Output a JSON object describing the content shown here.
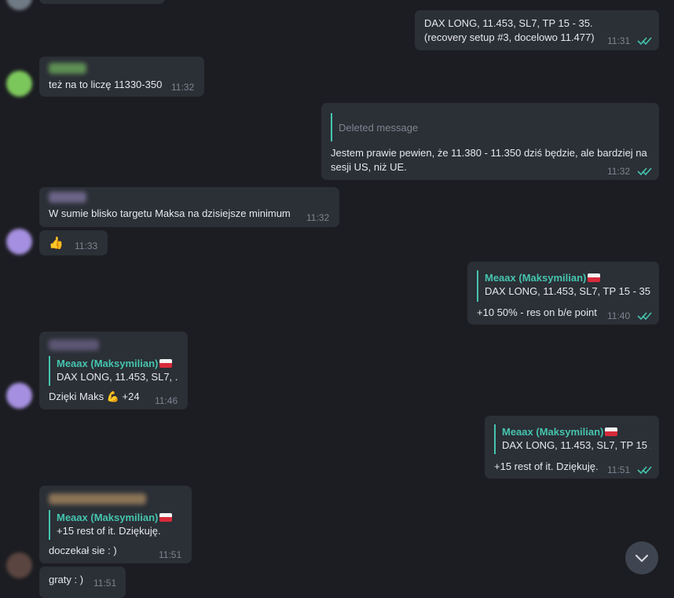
{
  "messages": {
    "m1": {
      "line1": "DAX LONG, 11.453, SL7, TP 15 - 35.",
      "line2": "(recovery setup #3, docelowo 11.477)",
      "time": "11:31"
    },
    "m2": {
      "text": "też na to liczę 11330-350",
      "time": "11:32"
    },
    "m3": {
      "quote": "Deleted message",
      "text": "Jestem prawie pewien, że 11.380 - 11.350 dziś będzie, ale bardziej na sesji US, niż UE.",
      "time": "11:32"
    },
    "m4": {
      "text": "W sumie blisko targetu Maksa na dzisiejsze minimum",
      "time": "11:32"
    },
    "m5": {
      "emoji": "👍",
      "time": "11:33"
    },
    "m6": {
      "quote_name": "Meaax (Maksymilian)",
      "quote_text": "DAX LONG, 11.453, SL7, TP 15 - 35....",
      "text": "+10 50% - res on b/e point",
      "time": "11:40"
    },
    "m7": {
      "quote_name": "Meaax (Maksymilian)",
      "quote_text": "DAX LONG, 11.453, SL7, ...",
      "text": "Dzięki Maks",
      "emoji": "💪",
      "suffix": "+24",
      "time": "11:46"
    },
    "m8": {
      "quote_name": "Meaax (Maksymilian)",
      "quote_text": "DAX LONG, 11.453, SL7, TP 15 ...",
      "text": "+15 rest of it. Dziękuję.",
      "time": "11:51"
    },
    "m9": {
      "quote_name": "Meaax (Maksymilian)",
      "quote_text": "+15 rest of it. Dziękuję.",
      "text": "doczekał sie : )",
      "time": "11:51"
    },
    "m10": {
      "text": "graty : )",
      "time": "11:51"
    }
  },
  "colors": {
    "accent": "#45c4ae",
    "bubble": "#2b2f36",
    "background": "#1c1d22",
    "check": "#45c4ae"
  },
  "icons": {
    "read_checks": "double-check-icon",
    "scroll_down": "chevron-down-icon",
    "flag": "poland-flag-icon"
  }
}
